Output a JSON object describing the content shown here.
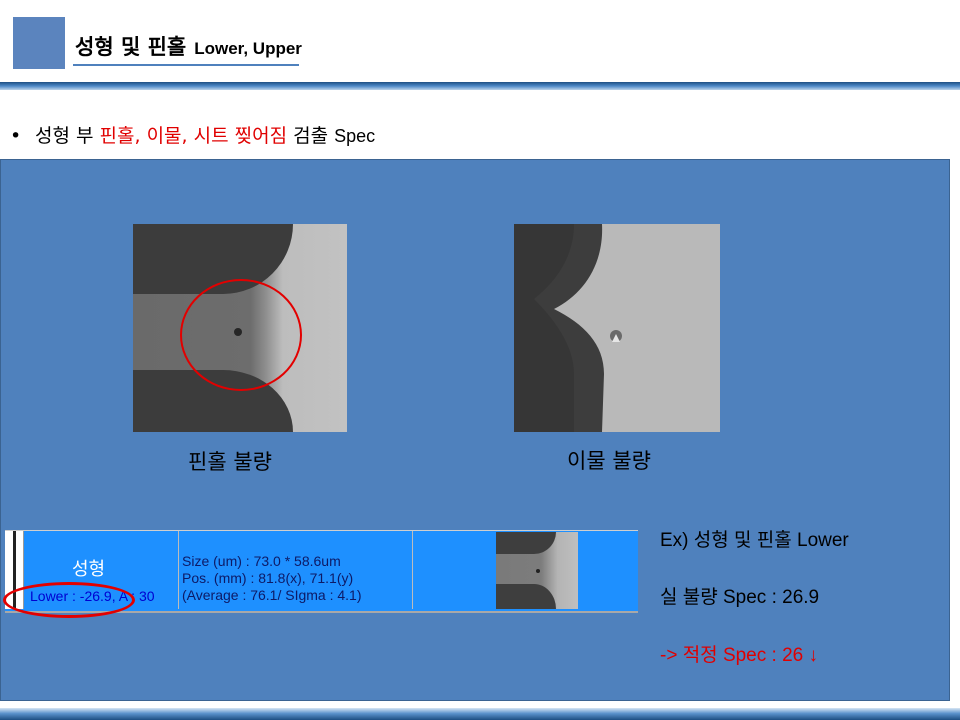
{
  "header": {
    "title": "성형 및 핀홀",
    "subtitle": "Lower, Upper"
  },
  "bullet": {
    "part1": "성형 부 ",
    "highlight": "핀홀, 이물, 시트 찢어짐",
    "part2": " 검출 ",
    "part3": "Spec"
  },
  "images": [
    {
      "caption": "핀홀 불량"
    },
    {
      "caption": "이물 불량"
    }
  ],
  "result_row": {
    "name": "성형",
    "lower": "Lower : -26.9, A : 30",
    "size": "Size (um) : 73.0 * 58.6um",
    "pos": "Pos. (mm) : 81.8(x), 71.1(y)",
    "avg": "(Average : 76.1/ SIgma : 4.1)"
  },
  "notes": {
    "line1": "Ex) 성형 및 핀홀 Lower",
    "line2": "실 불량 Spec : 26.9",
    "line3": "-> 적정 Spec : 26 ↓"
  },
  "colors": {
    "accent": "#4f81bd",
    "highlight_red": "#e00000",
    "bar_blue": "#1e90ff"
  }
}
